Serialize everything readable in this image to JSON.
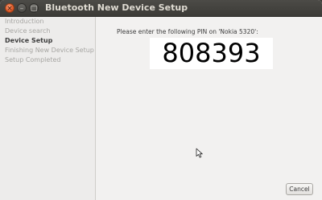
{
  "window": {
    "title": "Bluetooth New Device Setup",
    "controls": {
      "close": "×",
      "minimize": "–",
      "maximize": "□"
    }
  },
  "sidebar": {
    "steps": [
      {
        "label": "Introduction",
        "state": "done"
      },
      {
        "label": "Device search",
        "state": "done"
      },
      {
        "label": "Device Setup",
        "state": "active"
      },
      {
        "label": "Finishing New Device Setup",
        "state": "pending"
      },
      {
        "label": "Setup Completed",
        "state": "pending"
      }
    ]
  },
  "main": {
    "prompt": "Please enter the following PIN on 'Nokia 5320':",
    "pin": "808393",
    "cancel_label": "Cancel"
  },
  "colors": {
    "titlebar": "#3c3b37",
    "close_button": "#e35a27",
    "background": "#f2f1f0",
    "active_step": "#3c3c3c",
    "inactive_step": "#a7a6a3"
  },
  "icons": [
    "close-icon",
    "minimize-icon",
    "maximize-icon",
    "mouse-pointer-icon"
  ]
}
